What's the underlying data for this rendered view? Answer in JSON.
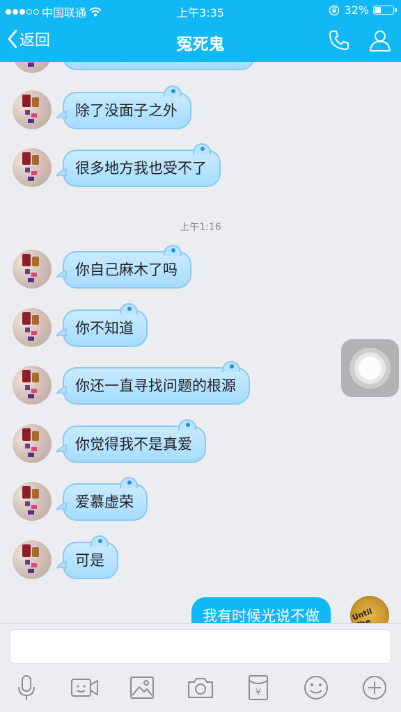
{
  "status_bar": {
    "carrier": "中国联通",
    "time": "上午3:35",
    "battery_text": "32%",
    "battery_level": 0.32
  },
  "navbar": {
    "back_label": "返回",
    "title": "冤死鬼"
  },
  "messages": [
    {
      "text": "除了没面子之外"
    },
    {
      "text": "很多地方我也受不了"
    },
    {
      "text": "你自己麻木了吗"
    },
    {
      "text": "你不知道"
    },
    {
      "text": "你还一直寻找问题的根源"
    },
    {
      "text": "你觉得我不是真爱"
    },
    {
      "text": "爱慕虚荣"
    },
    {
      "text": "可是"
    }
  ],
  "timestamp": "上午1:16",
  "outgoing": {
    "text": "我有时候光说不做",
    "avatar_text": "Until The"
  },
  "toolbar": {
    "icons": [
      "microphone-icon",
      "video-icon",
      "image-icon",
      "camera-icon",
      "red-packet-icon",
      "emoji-icon",
      "plus-icon"
    ]
  },
  "colors": {
    "brand": "#12b7f5",
    "bubble_in": "#b9e4ff",
    "background": "#ebedf0"
  }
}
